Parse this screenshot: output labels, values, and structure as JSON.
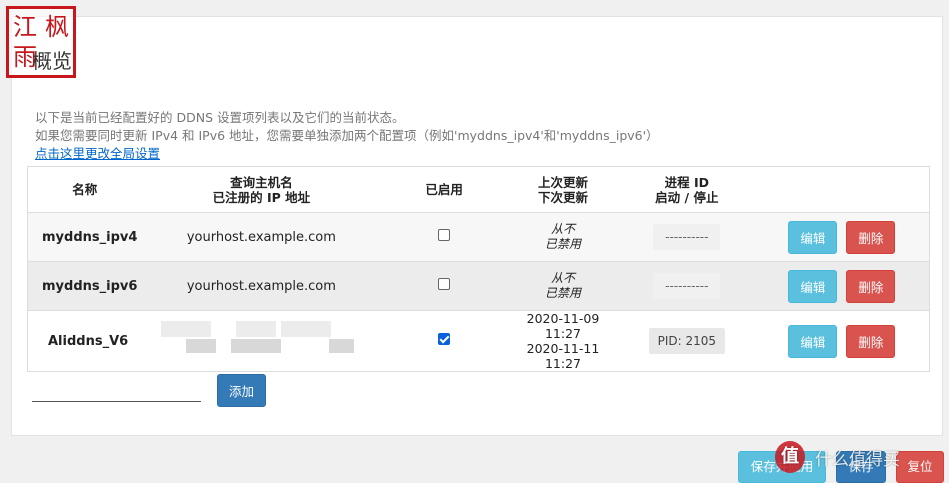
{
  "page": {
    "title": "概览",
    "desc_line1": "以下是当前已经配置好的 DDNS 设置项列表以及它们的当前状态。",
    "desc_line2": "如果您需要同时更新 IPv4 和 IPv6 地址，您需要单独添加两个配置项（例如'myddns_ipv4'和'myddns_ipv6'）",
    "global_link": "点击这里更改全局设置"
  },
  "stamp": {
    "chars": [
      "江",
      "枫",
      "雨"
    ]
  },
  "table": {
    "headers": {
      "name": "名称",
      "host_line1": "查询主机名",
      "host_line2": "已注册的 IP 地址",
      "enabled": "已启用",
      "update_line1": "上次更新",
      "update_line2": "下次更新",
      "process_line1": "进程 ID",
      "process_line2": "启动 / 停止"
    },
    "rows": [
      {
        "name": "myddns_ipv4",
        "host": "yourhost.example.com",
        "enabled": false,
        "last_update": "从不",
        "next_update": "已禁用",
        "process": "----------",
        "edit": "编辑",
        "delete": "删除"
      },
      {
        "name": "myddns_ipv6",
        "host": "yourhost.example.com",
        "enabled": false,
        "last_update": "从不",
        "next_update": "已禁用",
        "process": "----------",
        "edit": "编辑",
        "delete": "删除"
      },
      {
        "name": "Aliddns_V6",
        "host": "",
        "enabled": true,
        "last_update": "2020-11-09 11:27",
        "next_update": "2020-11-11 11:27",
        "process": "PID: 2105",
        "edit": "编辑",
        "delete": "删除"
      }
    ]
  },
  "add": {
    "input_value": "",
    "button": "添加"
  },
  "footer": {
    "save_apply": "保存并应用",
    "save": "保存",
    "reset": "复位"
  },
  "watermark": {
    "logo": "值",
    "text": "什么值得买"
  },
  "colors": {
    "info": "#5bc0de",
    "danger": "#d9534f",
    "primary": "#337ab7",
    "link": "#0066cc"
  }
}
